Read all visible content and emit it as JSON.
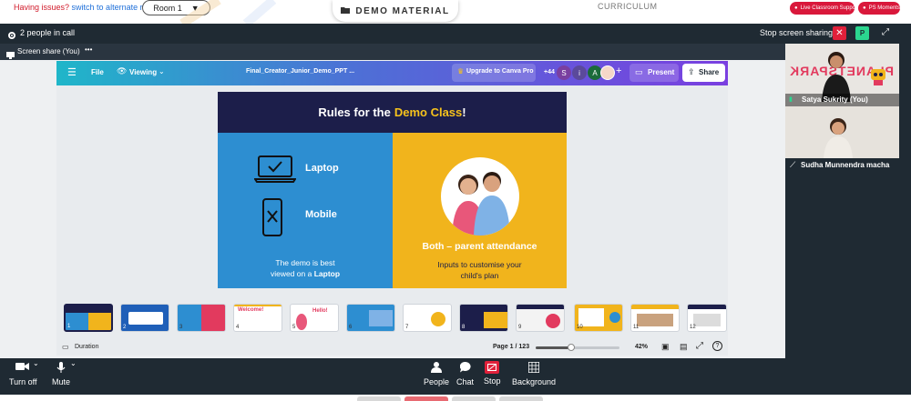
{
  "topbar": {
    "issue_prefix": "Having issues?",
    "issue_link": "switch to alternate room",
    "room_label": "Room 1",
    "demo_material": "DEMO MATERIAL",
    "curriculum": "CURRICULUM",
    "live_support": "Live Classroom Support",
    "ps_moments": "PS Moments"
  },
  "callbar": {
    "people_count": "2 people in call",
    "stop_sharing": "Stop screen sharing",
    "participant_initial": "P"
  },
  "sharehead": {
    "label": "Screen share (You)",
    "more": "•••"
  },
  "canva": {
    "file": "File",
    "viewing": "Viewing",
    "doc_title": "Final_Creator_Junior_Demo_PPT ...",
    "upgrade": "Upgrade to Canva Pro",
    "collab_count": "+44",
    "avatars": [
      "S",
      "i",
      "A"
    ],
    "present": "Present",
    "share": "Share",
    "duration": "Duration",
    "page": "Page 1 / 123",
    "zoom": "42%",
    "zoom_fraction": 0.42
  },
  "slide": {
    "title_a": "Rules for the",
    "title_b": "Demo Class",
    "title_c": "!",
    "laptop": "Laptop",
    "mobile": "Mobile",
    "left_note_a": "The demo is best",
    "left_note_b": "viewed on a",
    "left_note_c": "Laptop",
    "right_heading": "Both – parent attendance",
    "right_note_a": "Inputs to customise your",
    "right_note_b": "child's plan"
  },
  "thumbnails": [
    {
      "num": "1"
    },
    {
      "num": "2"
    },
    {
      "num": "3"
    },
    {
      "num": "4"
    },
    {
      "num": "5"
    },
    {
      "num": "6"
    },
    {
      "num": "7"
    },
    {
      "num": "8"
    },
    {
      "num": "9"
    },
    {
      "num": "10"
    },
    {
      "num": "11"
    },
    {
      "num": "12"
    }
  ],
  "thumb_texts": {
    "welcome": "Welcome!",
    "hello": "Hello!"
  },
  "participants": [
    {
      "name": "Satya Sukrity (You)"
    },
    {
      "name": "Sudha Munnendra macha"
    }
  ],
  "participant_logo": "PLANETSPARK",
  "controls": {
    "turn_off": "Turn off",
    "mute": "Mute",
    "people": "People",
    "chat": "Chat",
    "stop": "Stop",
    "background": "Background"
  },
  "colors": {
    "topbar_red": "#d11a2a",
    "link_blue": "#1e6fd9",
    "call_bg": "#1f2a33",
    "slide_navy": "#1c1e4a",
    "slide_blue": "#2d8ed1",
    "slide_yellow": "#f1b41c",
    "accent_yellow": "#f6c21c",
    "stop_red": "#e0203a",
    "present_purple": "#7a3fe0"
  }
}
